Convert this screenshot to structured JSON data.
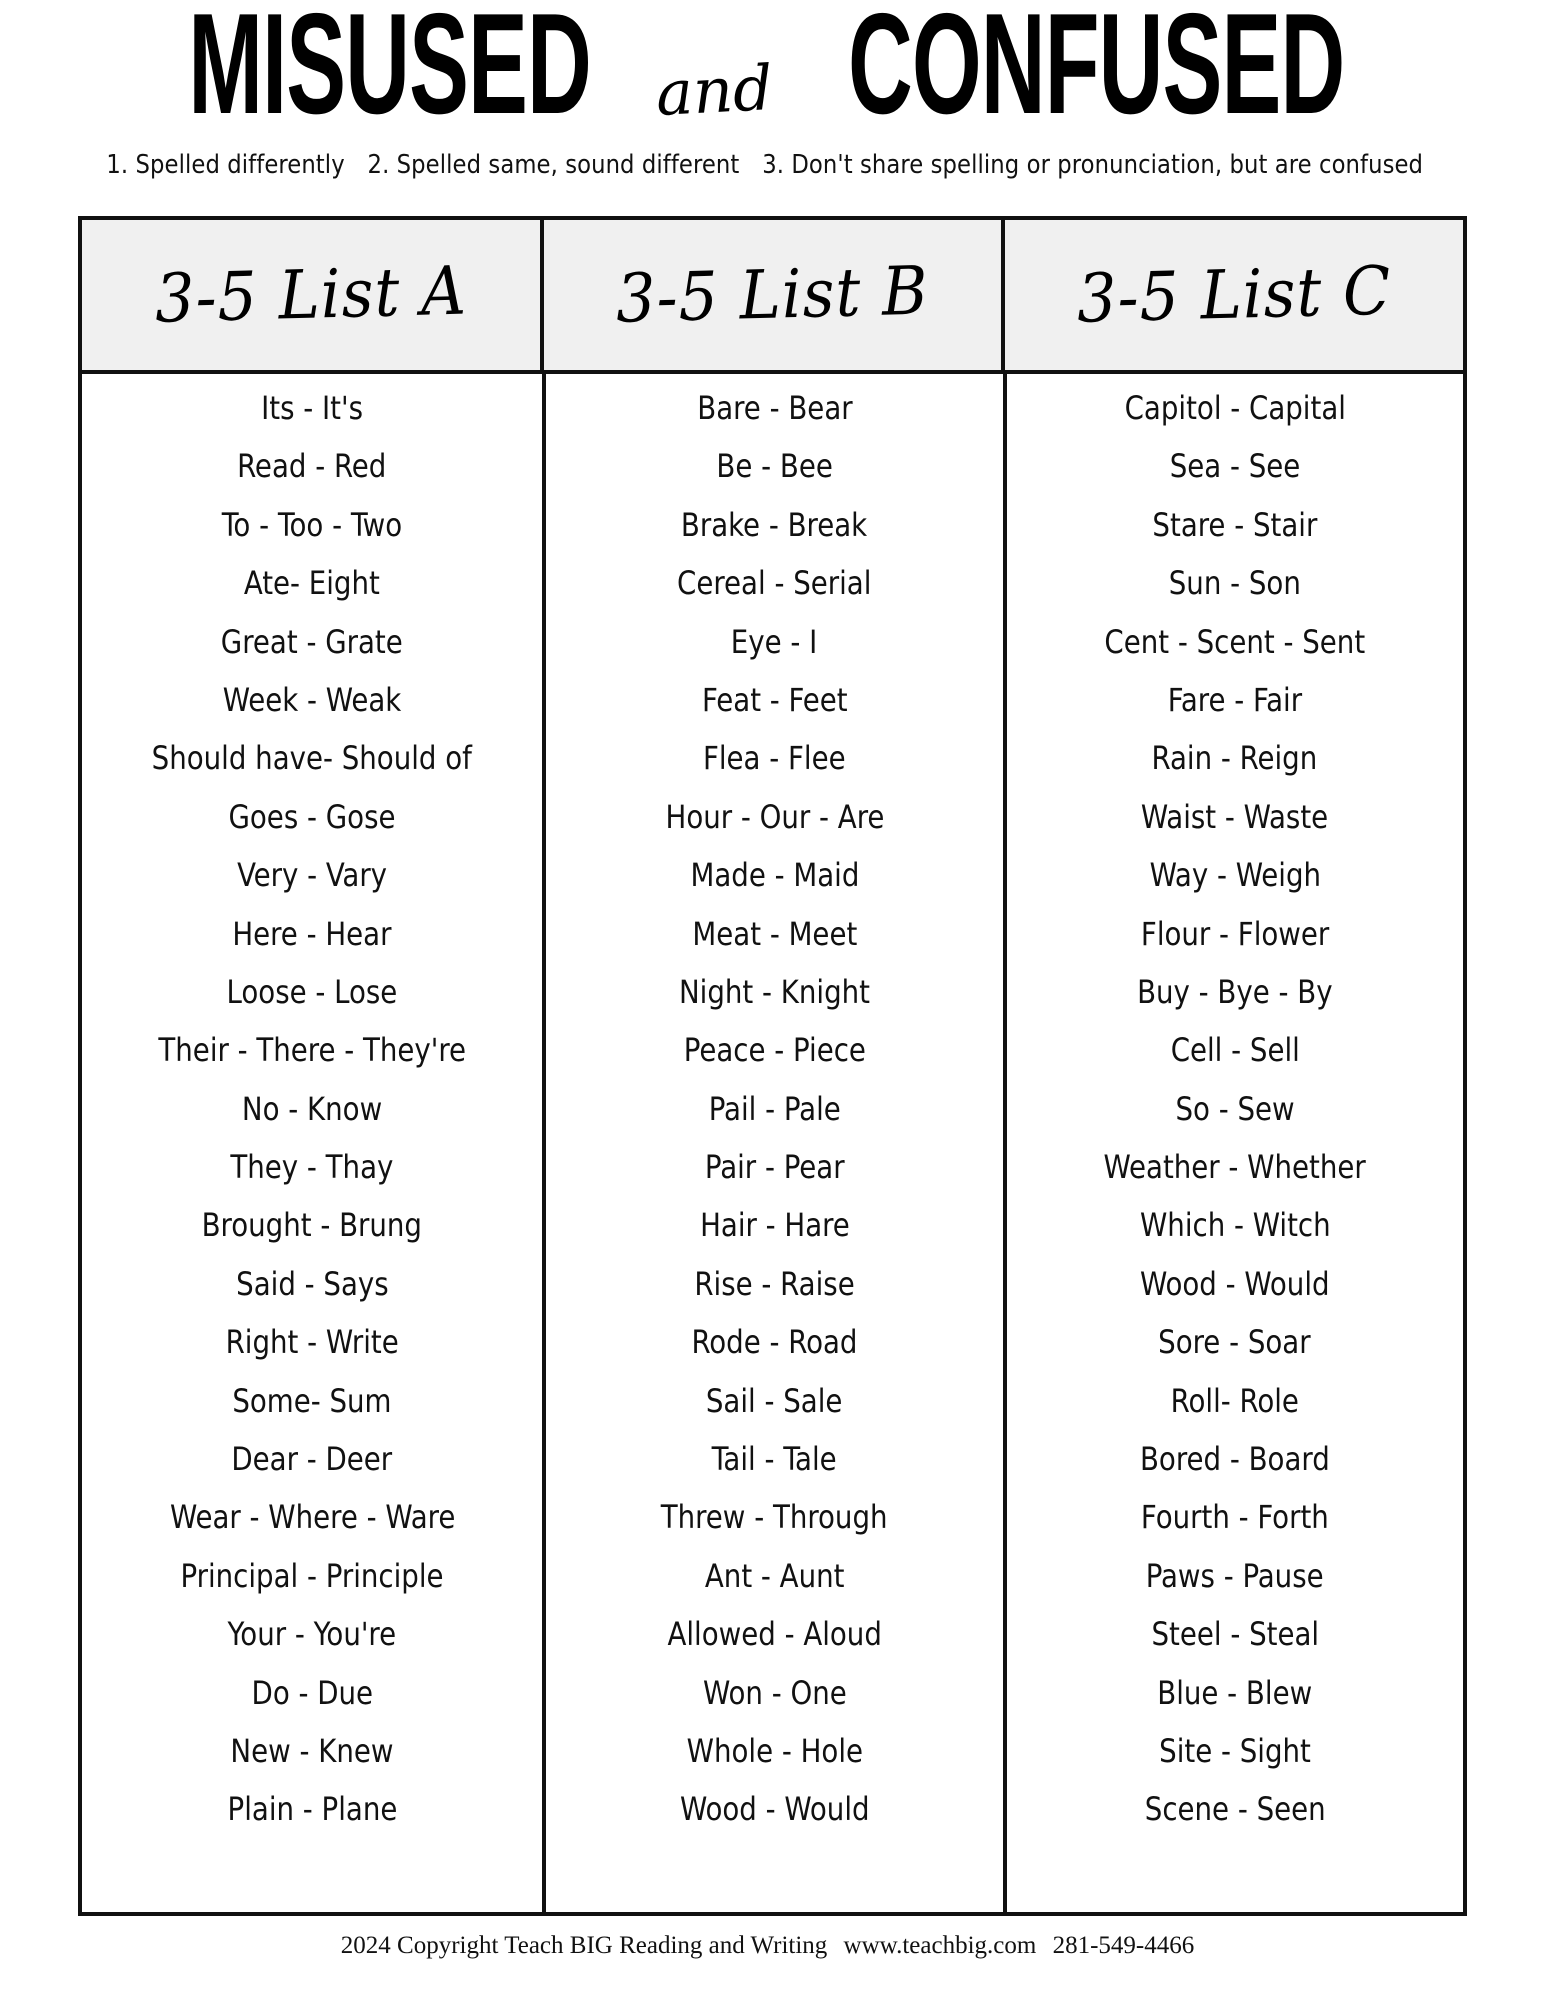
{
  "title": {
    "part1": "MISUSED",
    "conjunction": "and",
    "part2": "CONFUSED"
  },
  "subtitle": {
    "rule1": "1. Spelled differently",
    "rule2": "2. Spelled same, sound different",
    "rule3": "3. Don't share spelling or pronunciation, but are confused"
  },
  "columns": [
    {
      "header": "3-5 List A",
      "entries": [
        "Its - It's",
        "Read - Red",
        "To - Too - Two",
        "Ate- Eight",
        "Great - Grate",
        "Week - Weak",
        "Should have- Should of",
        "Goes - Gose",
        "Very - Vary",
        "Here - Hear",
        "Loose - Lose",
        "Their - There - They're",
        "No - Know",
        "They - Thay",
        "Brought - Brung",
        "Said - Says",
        "Right - Write",
        "Some- Sum",
        "Dear - Deer",
        "Wear - Where - Ware",
        "Principal - Principle",
        "Your - You're",
        "Do - Due",
        "New - Knew",
        "Plain - Plane"
      ]
    },
    {
      "header": "3-5 List B",
      "entries": [
        "Bare - Bear",
        "Be - Bee",
        "Brake - Break",
        "Cereal - Serial",
        "Eye - I",
        "Feat - Feet",
        "Flea - Flee",
        "Hour - Our - Are",
        "Made - Maid",
        "Meat - Meet",
        "Night - Knight",
        "Peace - Piece",
        "Pail - Pale",
        "Pair - Pear",
        "Hair - Hare",
        "Rise - Raise",
        "Rode - Road",
        "Sail - Sale",
        "Tail - Tale",
        "Threw - Through",
        "Ant - Aunt",
        "Allowed - Aloud",
        "Won - One",
        "Whole - Hole",
        "Wood - Would"
      ]
    },
    {
      "header": "3-5 List C",
      "entries": [
        "Capitol - Capital",
        "Sea - See",
        "Stare - Stair",
        "Sun - Son",
        "Cent - Scent - Sent",
        "Fare - Fair",
        "Rain - Reign",
        "Waist - Waste",
        "Way - Weigh",
        "Flour - Flower",
        "Buy - Bye - By",
        "Cell - Sell",
        "So - Sew",
        "Weather - Whether",
        "Which - Witch",
        "Wood - Would",
        "Sore - Soar",
        "Roll- Role",
        "Bored - Board",
        "Fourth - Forth",
        "Paws - Pause",
        "Steel - Steal",
        "Blue - Blew",
        "Site - Sight",
        "Scene - Seen"
      ]
    }
  ],
  "footer": {
    "copyright": "2024 Copyright Teach BIG Reading and Writing",
    "website": "www.teachbig.com",
    "phone": "281-549-4466"
  }
}
